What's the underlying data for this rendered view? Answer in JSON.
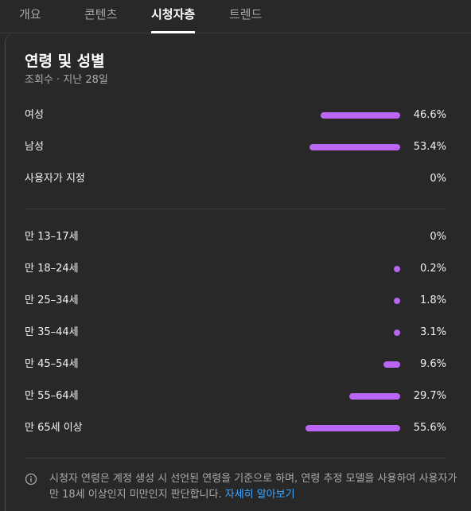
{
  "tabs": [
    {
      "label": "개요"
    },
    {
      "label": "콘텐츠"
    },
    {
      "label": "시청자층"
    },
    {
      "label": "트렌드"
    }
  ],
  "active_tab": "시청자층",
  "card": {
    "title": "연령 및 성별",
    "subtitle": "조회수 · 지난 28일"
  },
  "gender": [
    {
      "label": "여성",
      "value": "46.6%",
      "pct": 46.6
    },
    {
      "label": "남성",
      "value": "53.4%",
      "pct": 53.4
    },
    {
      "label": "사용자가 지정",
      "value": "0%",
      "pct": 0
    }
  ],
  "age": [
    {
      "label": "만 13–17세",
      "value": "0%",
      "pct": 0
    },
    {
      "label": "만 18–24세",
      "value": "0.2%",
      "pct": 0.2
    },
    {
      "label": "만 25–34세",
      "value": "1.8%",
      "pct": 1.8
    },
    {
      "label": "만 35–44세",
      "value": "3.1%",
      "pct": 3.1
    },
    {
      "label": "만 45–54세",
      "value": "9.6%",
      "pct": 9.6
    },
    {
      "label": "만 55–64세",
      "value": "29.7%",
      "pct": 29.7
    },
    {
      "label": "만 65세 이상",
      "value": "55.6%",
      "pct": 55.6
    }
  ],
  "footnote": {
    "line1": "시청자 연령은 계정 생성 시 선언된 연령을 기준으로 하며, 연령 추정 모델을 사용하여 사용자가",
    "line2": "만 18세 이상인지 미만인지 판단합니다.",
    "link": "자세히 알아보기"
  },
  "colors": {
    "background": "#282828",
    "bar": "#bb66f2",
    "link": "#3ea6ff",
    "text_secondary": "#aaaaaa"
  }
}
